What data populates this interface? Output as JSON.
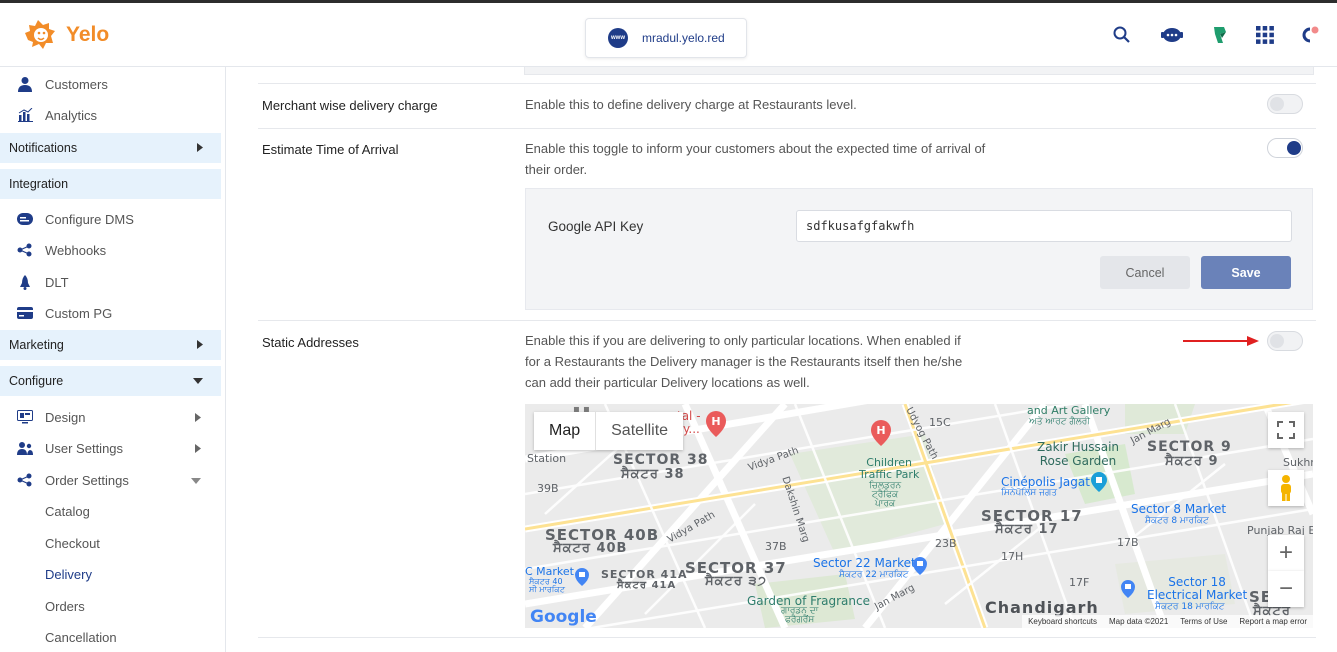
{
  "header": {
    "brand": "Yelo",
    "domain": "mradul.yelo.red",
    "www_badge": "www",
    "icons": [
      "search-icon",
      "chat-support-icon",
      "marketplace-icon",
      "apps-grid-icon",
      "notifications-icon"
    ]
  },
  "sidebar": {
    "items_top": [
      {
        "label": "Customers",
        "icon": "user-icon"
      },
      {
        "label": "Analytics",
        "icon": "bar-chart-icon"
      }
    ],
    "sections": {
      "notifications": "Notifications",
      "integration": "Integration",
      "marketing": "Marketing",
      "configure": "Configure"
    },
    "integration_items": [
      {
        "label": "Configure DMS",
        "icon": "dms-icon"
      },
      {
        "label": "Webhooks",
        "icon": "webhook-icon"
      },
      {
        "label": "DLT",
        "icon": "bell-icon"
      },
      {
        "label": "Custom PG",
        "icon": "card-icon"
      }
    ],
    "configure_items": [
      {
        "label": "Design",
        "icon": "monitor-icon"
      },
      {
        "label": "User Settings",
        "icon": "users-icon"
      },
      {
        "label": "Order Settings",
        "icon": "flow-icon"
      }
    ],
    "order_settings_items": [
      "Catalog",
      "Checkout",
      "Delivery",
      "Orders",
      "Cancellation"
    ],
    "active_item": "Delivery"
  },
  "settings": {
    "merchant": {
      "label": "Merchant wise delivery charge",
      "description": "Enable this to define delivery charge at Restaurants level.",
      "enabled": false
    },
    "eta": {
      "label": "Estimate Time of Arrival",
      "description_line1": "Enable this toggle to inform your customers about the expected time of arrival of",
      "description_line2": "their order.",
      "enabled": true,
      "api_key_label": "Google API Key",
      "api_key_value": "sdfkusafgfakwfh",
      "cancel_label": "Cancel",
      "save_label": "Save"
    },
    "static": {
      "label": "Static Addresses",
      "description_line1": "Enable this if you are delivering to only particular locations. When enabled if",
      "description_line2": "for a Restaurants the Delivery manager is the Restaurants itself then he/she",
      "description_line3": "can add their particular Delivery locations as well.",
      "enabled": false
    }
  },
  "map": {
    "type_map": "Map",
    "type_satellite": "Satellite",
    "labels": {
      "sector38": "SECTOR 38",
      "sector38_pa": "ਸੈਕਟਰ 38",
      "sector40b": "SECTOR 40B",
      "sector40b_pa": "ਸੈਕਟਰ 40B",
      "sector37": "SECTOR 37",
      "sector37_pa": "ਸੈਕਟਰ ੩੭",
      "sector41a": "SECTOR 41A",
      "sector41a_pa": "ਸੈਕਟਰ 41A",
      "sector17": "SECTOR 17",
      "sector17_pa": "ਸੈਕਟਰ 17",
      "sector9": "SECTOR 9",
      "sector9_pa": "ਸੈਕਟਰ 9",
      "sector_partial": "SEC",
      "sector_partial_pa": "ਸੈਕਟਰ",
      "chandigarh": "Chandigarh",
      "station": "Station",
      "c39b": "39B",
      "c37b": "37B",
      "c23b": "23B",
      "c15c": "15C",
      "c17h": "17H",
      "c17b": "17B",
      "c17f": "17F",
      "vidya_path": "Vidya Path",
      "vidya_path2": "Vidya Path",
      "dakshin_marg": "Dakshin Marg",
      "udyog_path": "Udyog Path",
      "jan_marg": "Jan Marg",
      "jan_marg2": "Jan Marg",
      "sukhna": "Sukhn",
      "punjab_raj": "Punjab Raj E",
      "children_park": "Children\nTraffic Park",
      "children_park_pa": "ਚਿਲਡਰਨ\nਟ੍ਰੈਫਿਕ\nਪਾਰਕ",
      "zakir": "Zakir Hussain\nRose Garden",
      "art_gallery": "and Art Gallery",
      "art_gallery_pa": "ਅਤੇ ਆਰਟ ਗੈਲਰੀ",
      "cinepolis": "Cinépolis Jagat",
      "cinepolis_pa": "ਸਿਨੇਪੋਲਿਸ ਜਗਤ",
      "sector8_market": "Sector 8 Market",
      "sector8_market_pa": "ਸੈਕਟਰ 8 ਮਾਰਕਿਟ",
      "sector22_market": "Sector 22 Market",
      "sector22_market_pa": "ਸੈਕਟਰ 22 ਮਾਰਕਿਟ",
      "sector18": "Sector 18\nElectrical Market",
      "sector18_pa": "ਸੈਕਟਰ 18 ਮਾਰਕਿਟ",
      "garden_fragrance": "Garden of Fragrance",
      "garden_fragrance_pa": "ਗਾਰਡਨ ਦਾ\nਫਰੈਗਰੈਂਸ",
      "c_market": "C Market",
      "c_market_pa": "ਸੈਕਟਰ 40\nਸੀ ਮਾਰਕਿਟ",
      "hospital": "tal -",
      "hospital2": "ity...",
      "google": "Google"
    },
    "attribution": [
      "Keyboard shortcuts",
      "Map data ©2021",
      "Terms of Use",
      "Report a map error"
    ],
    "controls": {
      "zoom_in": "+",
      "zoom_out": "−"
    }
  }
}
